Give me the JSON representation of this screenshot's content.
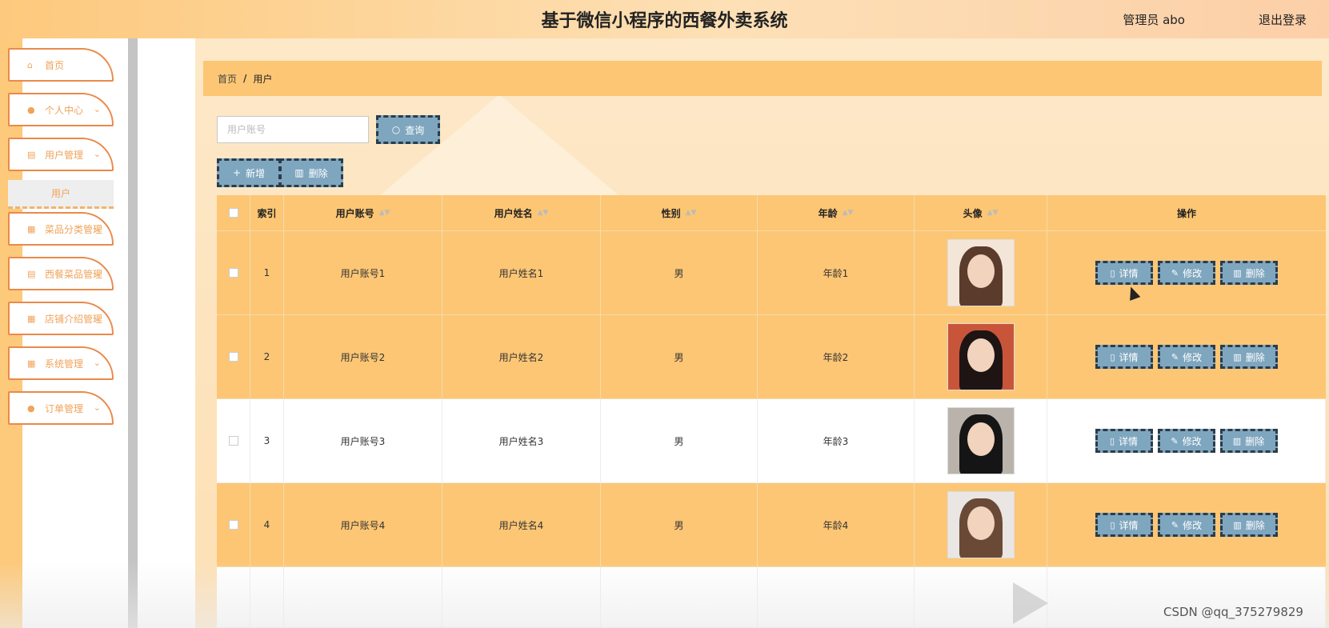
{
  "header": {
    "title": "基于微信小程序的西餐外卖系统",
    "user_label": "管理员 abo",
    "logout_label": "退出登录"
  },
  "sidebar": {
    "items": [
      {
        "label": "首页",
        "icon": "home-icon",
        "has_chevron": false
      },
      {
        "label": "个人中心",
        "icon": "user-icon",
        "has_chevron": true
      },
      {
        "label": "用户管理",
        "icon": "clipboard-icon",
        "has_chevron": true
      },
      {
        "label": "菜品分类管理",
        "icon": "grid-icon",
        "has_chevron": true
      },
      {
        "label": "西餐菜品管理",
        "icon": "clipboard-icon",
        "has_chevron": true
      },
      {
        "label": "店铺介绍管理",
        "icon": "grid-icon",
        "has_chevron": true
      },
      {
        "label": "系统管理",
        "icon": "grid-icon",
        "has_chevron": true
      },
      {
        "label": "订单管理",
        "icon": "user-icon",
        "has_chevron": true
      }
    ],
    "submenu_active": "用户"
  },
  "breadcrumb": {
    "home": "首页",
    "separator": "/",
    "current": "用户"
  },
  "toolbar": {
    "search_placeholder": "用户账号",
    "search_label": "查询",
    "add_label": "新增",
    "delete_label": "删除"
  },
  "table": {
    "headers": [
      "索引",
      "用户账号",
      "用户姓名",
      "性别",
      "年龄",
      "头像",
      "操作"
    ],
    "rows": [
      {
        "index": "1",
        "account": "用户账号1",
        "name": "用户姓名1",
        "gender": "男",
        "age": "年龄1"
      },
      {
        "index": "2",
        "account": "用户账号2",
        "name": "用户姓名2",
        "gender": "男",
        "age": "年龄2"
      },
      {
        "index": "3",
        "account": "用户账号3",
        "name": "用户姓名3",
        "gender": "男",
        "age": "年龄3"
      },
      {
        "index": "4",
        "account": "用户账号4",
        "name": "用户姓名4",
        "gender": "男",
        "age": "年龄4"
      }
    ],
    "actions": {
      "detail": "详情",
      "edit": "修改",
      "delete": "删除"
    }
  },
  "watermark": "CSDN @qq_375279829",
  "colors": {
    "accent_orange": "#fdc674",
    "button_blue": "#7fa6bf",
    "menu_border": "#ea8a4a"
  }
}
